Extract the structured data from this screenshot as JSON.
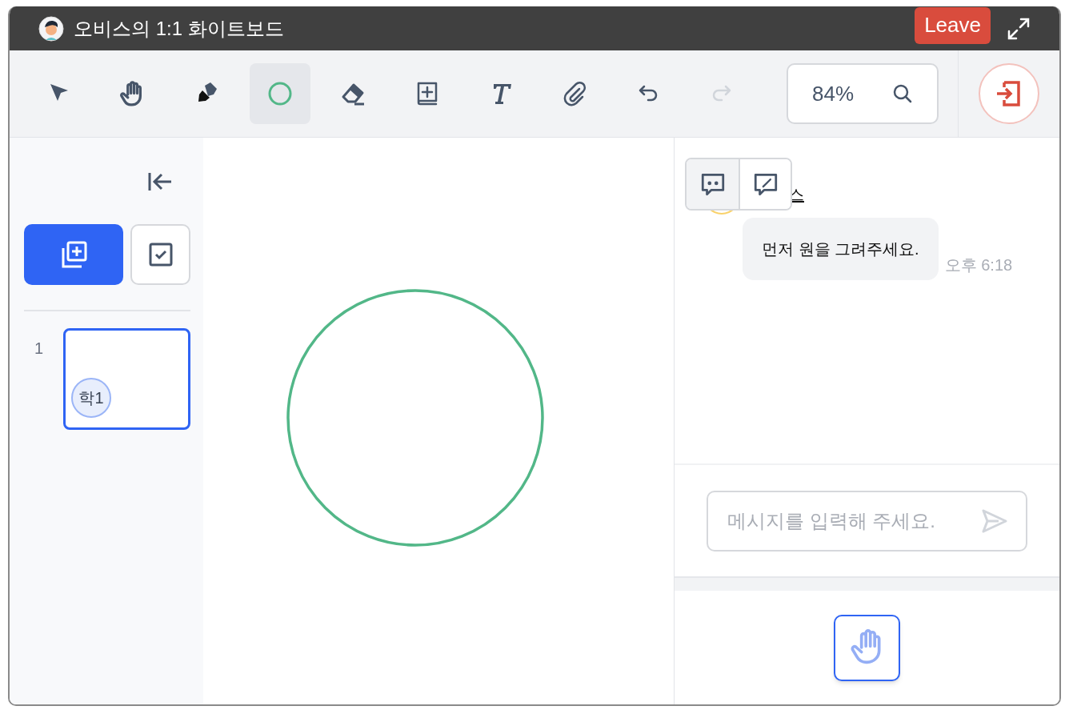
{
  "window": {
    "title": "오비스의 1:1 화이트보드",
    "leave_button": "Leave"
  },
  "toolbar": {
    "tools": [
      {
        "kind": "select",
        "selected": false,
        "disabled": false
      },
      {
        "kind": "hand",
        "selected": false,
        "disabled": false
      },
      {
        "kind": "highlighter",
        "selected": false,
        "disabled": false
      },
      {
        "kind": "circle",
        "selected": true,
        "disabled": false
      },
      {
        "kind": "eraser",
        "selected": false,
        "disabled": false
      },
      {
        "kind": "add",
        "selected": false,
        "disabled": false
      },
      {
        "kind": "text",
        "selected": false,
        "disabled": false
      },
      {
        "kind": "attach",
        "selected": false,
        "disabled": false
      },
      {
        "kind": "undo",
        "selected": false,
        "disabled": false
      },
      {
        "kind": "redo",
        "selected": false,
        "disabled": true
      }
    ],
    "zoom": "84%"
  },
  "sidebar": {
    "pages": [
      {
        "number": "1",
        "selected": true,
        "badge": "학1"
      }
    ]
  },
  "canvas": {
    "shapes": [
      {
        "kind": "circle"
      }
    ]
  },
  "chat": {
    "tabs": [
      {
        "kind": "chat",
        "selected": true
      },
      {
        "kind": "note",
        "selected": false
      }
    ],
    "messages": [
      {
        "sender": "스",
        "text": "먼저 원을 그려주세요.",
        "time": "오후 6:18"
      }
    ],
    "input": {
      "placeholder": "메시지를 입력해 주세요."
    }
  }
}
